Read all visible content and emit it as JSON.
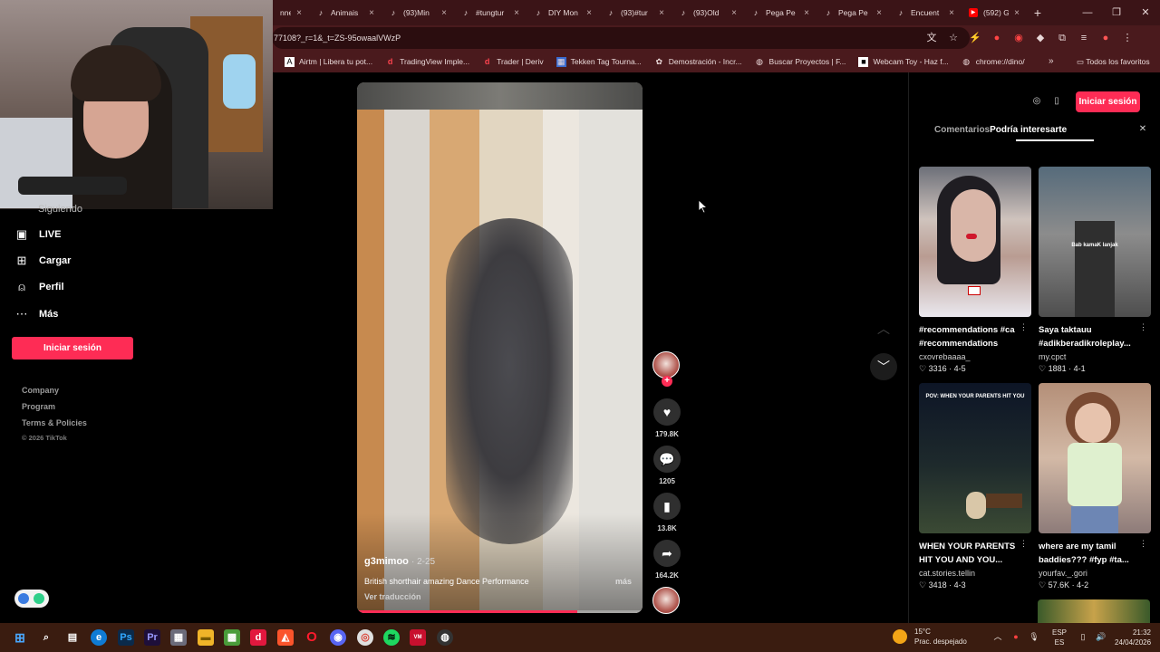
{
  "browser": {
    "tabs": [
      {
        "title": "nne",
        "icon": ""
      },
      {
        "title": "Animais",
        "icon": "tiktok-icon"
      },
      {
        "title": "(93)Min",
        "icon": "tiktok-icon"
      },
      {
        "title": "#tungtur",
        "icon": "tiktok-icon"
      },
      {
        "title": "DIY Mon",
        "icon": "tiktok-icon"
      },
      {
        "title": "(93)#tur",
        "icon": "tiktok-icon"
      },
      {
        "title": "(93)Old",
        "icon": "tiktok-icon"
      },
      {
        "title": "Pega Pe",
        "icon": "tiktok-icon"
      },
      {
        "title": "Pega Pe",
        "icon": "tiktok-icon"
      },
      {
        "title": "Encuent",
        "icon": "tiktok-icon"
      },
      {
        "title": "(592) G",
        "icon": "youtube-icon"
      }
    ],
    "url": "77108?_r=1&_t=ZS-95owaalVWzP",
    "bookmarks": [
      {
        "label": "Airtm | Libera tu pot...",
        "icon": "airtm-icon"
      },
      {
        "label": "TradingView Imple...",
        "icon": "deriv-icon"
      },
      {
        "label": "Trader | Deriv",
        "icon": "deriv-icon"
      },
      {
        "label": "Tekken Tag Tourna...",
        "icon": "tekken-icon"
      },
      {
        "label": "Demostración - Incr...",
        "icon": "gear-icon"
      },
      {
        "label": "Buscar Proyectos | F...",
        "icon": "globe-icon"
      },
      {
        "label": "Webcam Toy - Haz f...",
        "icon": "webcam-icon"
      },
      {
        "label": "chrome://dino/",
        "icon": "globe-icon"
      }
    ],
    "all_bookmarks": "Todos los favoritos"
  },
  "sidebar": {
    "partial_item": "Siguiendo",
    "items": [
      {
        "label": "LIVE",
        "icon": "live-icon"
      },
      {
        "label": "Cargar",
        "icon": "upload-icon"
      },
      {
        "label": "Perfil",
        "icon": "profile-icon"
      },
      {
        "label": "Más",
        "icon": "more-icon"
      }
    ],
    "login_label": "Iniciar sesión",
    "footer_links": [
      "Company",
      "Program",
      "Terms & Policies"
    ],
    "copyright": "© 2026 TikTok"
  },
  "video": {
    "author": "g3mimoo",
    "date": "· 2-25",
    "description": "British shorthair amazing Dance Performance",
    "more_label": "más",
    "translate_label": "Ver traducción",
    "progress": 0.77,
    "likes": "179.8K",
    "comments": "1205",
    "saves": "13.8K",
    "shares": "164.2K"
  },
  "panel": {
    "login_label": "Iniciar sesión",
    "tabs": [
      "Comentarios",
      "Podría interesarte"
    ],
    "active_tab": 1,
    "cards": [
      {
        "title": "#recommendations #ca #recommendations",
        "author": "cxovrebaaaa_",
        "likes": "3316",
        "date": "4-5",
        "thumb_text": ""
      },
      {
        "title": "Saya taktauu #adikberadikroleplay...",
        "author": "my.cpct",
        "likes": "1881",
        "date": "4-1",
        "thumb_text": "Bab kamaK lanjak"
      },
      {
        "title": "WHEN YOUR PARENTS HIT YOU AND YOU...",
        "author": "cat.stories.tellin",
        "likes": "3418",
        "date": "4-3",
        "thumb_text": "POV: WHEN YOUR PARENTS HIT YOU"
      },
      {
        "title": "where are my tamil baddies??? #fyp #ta...",
        "author": "yourfav._.gori",
        "likes": "57.6K",
        "date": "4-2",
        "thumb_text": ""
      }
    ]
  },
  "taskbar": {
    "weather_temp": "15°C",
    "weather_desc": "Prac. despejado",
    "lang_top": "ESP",
    "lang_bottom": "ES",
    "time": "21:32",
    "date": "24/04/2026"
  }
}
